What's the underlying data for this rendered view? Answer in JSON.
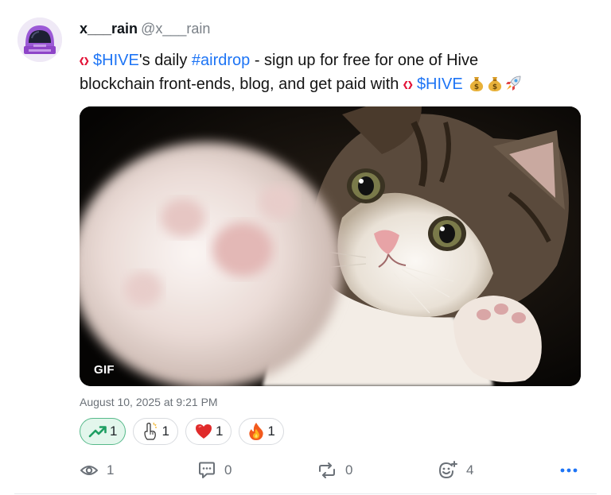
{
  "author": {
    "display_name": "x___rain",
    "handle": "@x___rain",
    "avatar_icon": "astronaut-helmet-icon"
  },
  "post": {
    "line1": {
      "ticker": "$HIVE",
      "text_a": "'s daily ",
      "hashtag": "#airdrop",
      "text_b": " - sign up for free for one of Hive"
    },
    "line2": {
      "text": "blockchain front-ends, blog, and get paid with ",
      "ticker": "$HIVE"
    },
    "emojis": [
      "money-bag-emoji",
      "money-bag-emoji",
      "rocket-emoji"
    ]
  },
  "media": {
    "badge": "GIF",
    "description_icon": "kitten-gif"
  },
  "timestamp": "August 10, 2025 at 9:21 PM",
  "reactions": [
    {
      "icon": "trending-up-icon",
      "count": "1",
      "active": true
    },
    {
      "icon": "pointing-up-hand-icon",
      "count": "1",
      "active": false
    },
    {
      "icon": "red-heart-icon",
      "count": "1",
      "active": false
    },
    {
      "icon": "fire-icon",
      "count": "1",
      "active": false
    }
  ],
  "actions": {
    "views": "1",
    "replies": "0",
    "reposts": "0",
    "reactions": "4"
  },
  "colors": {
    "link": "#1d74f5",
    "hive_red": "#e31337",
    "active_reaction_bg": "#e3f6ec",
    "active_reaction_border": "#56b98a",
    "more_icon": "#1d74f5"
  }
}
